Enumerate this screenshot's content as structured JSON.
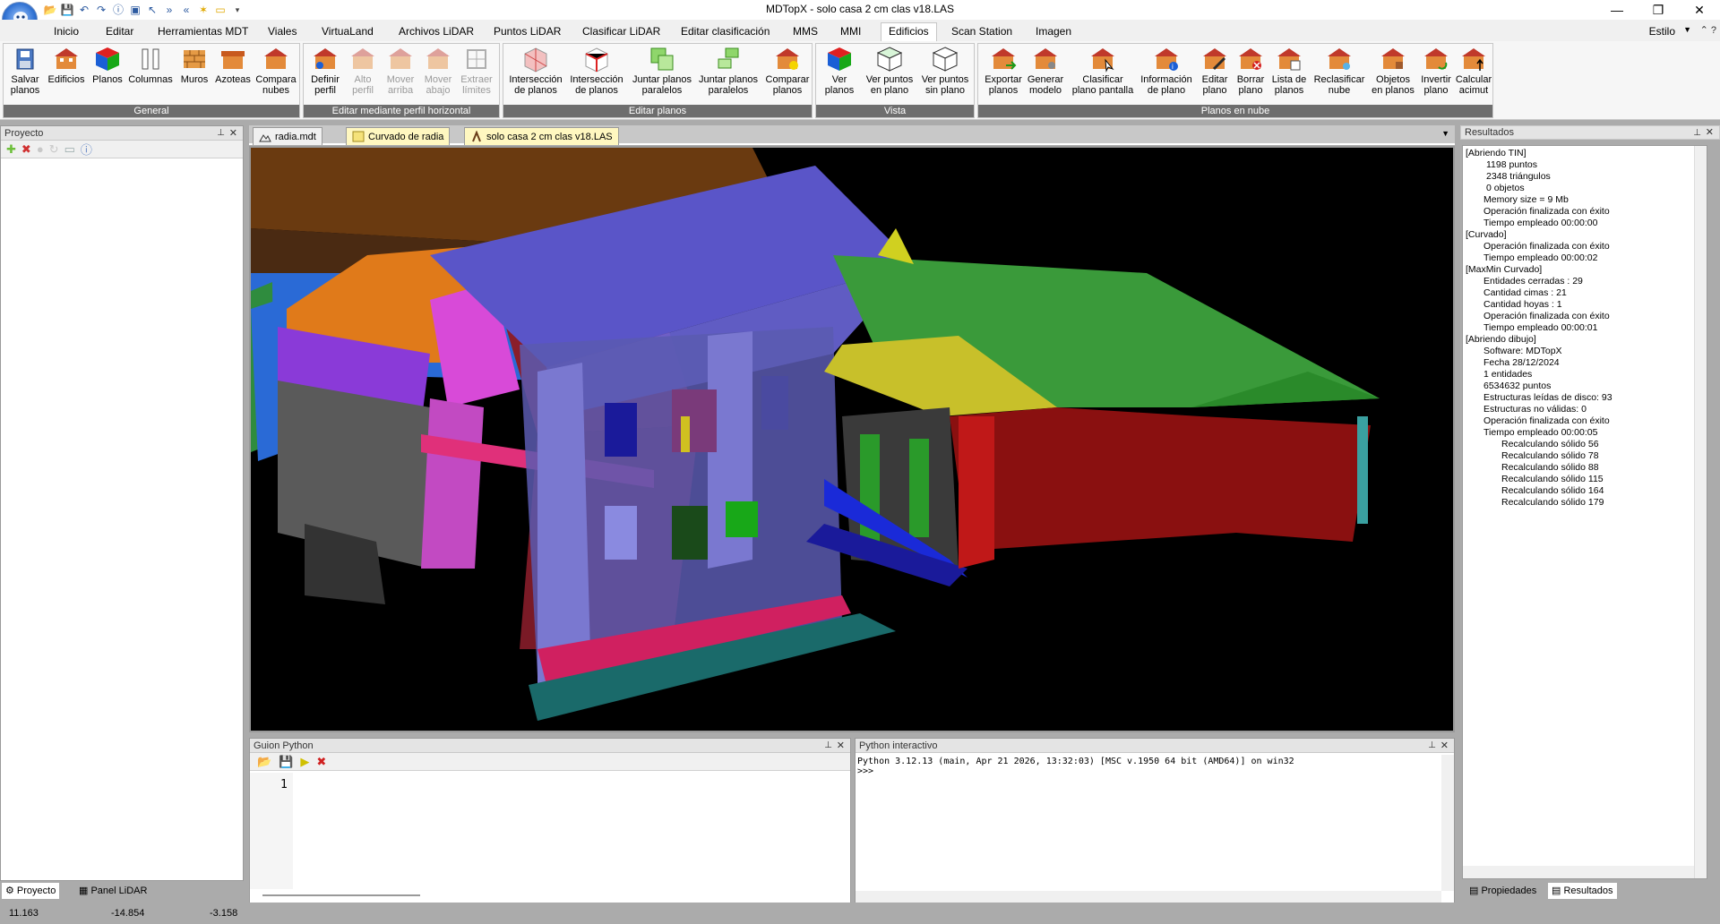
{
  "titlebar": {
    "title": "MDTopX - solo casa 2 cm clas v18.LAS",
    "controls": [
      "—",
      "❐",
      "✕"
    ]
  },
  "menu": {
    "tabs": [
      "Inicio",
      "Editar",
      "Herramientas MDT",
      "Viales",
      "VirtuaLand",
      "Archivos LiDAR",
      "Puntos LiDAR",
      "Clasificar LiDAR",
      "Editar clasificación",
      "MMS",
      "MMI",
      "Edificios",
      "Scan Station",
      "Imagen"
    ],
    "active_tab": "Edificios",
    "style_label": "Estilo"
  },
  "ribbon": {
    "groups": [
      {
        "label": "General",
        "buttons": [
          "Salvar\nplanos",
          "Edificios",
          "Planos",
          "Columnas",
          "Muros",
          "Azoteas",
          "Compara\nnubes"
        ]
      },
      {
        "label": "Editar mediante perfil horizontal",
        "buttons": [
          "Definir\nperfil",
          "Alto\nperfil",
          "Mover\narriba",
          "Mover\nabajo",
          "Extraer\nlímites"
        ]
      },
      {
        "label": "Editar planos",
        "buttons": [
          "Intersección\nde planos",
          "Intersección\nde planos",
          "Juntar planos\nparalelos",
          "Juntar planos\nparalelos",
          "Comparar\nplanos"
        ]
      },
      {
        "label": "Vista",
        "buttons": [
          "Ver\nplanos",
          "Ver puntos\nen plano",
          "Ver puntos\nsin plano"
        ]
      },
      {
        "label": "Planos en nube",
        "buttons": [
          "Exportar\nplanos",
          "Generar\nmodelo",
          "Clasificar\nplano pantalla",
          "Información\nde plano",
          "Editar\nplano",
          "Borrar\nplano",
          "Lista de\nplanos",
          "Reclasificar\nnube",
          "Objetos\nen planos",
          "Invertir\nplano",
          "Calcular\nacimut"
        ]
      }
    ]
  },
  "left_panel": {
    "title": "Proyecto",
    "tabs": [
      "Proyecto",
      "Panel LiDAR"
    ]
  },
  "doc_tabs": [
    "radia.mdt",
    "Curvado de radia",
    "solo casa 2 cm clas v18.LAS"
  ],
  "python_script": {
    "title": "Guion Python",
    "line_number": "1"
  },
  "python_interactive": {
    "title": "Python interactivo",
    "lines": [
      "Python 3.12.13 (main, Apr 21 2026, 13:32:03) [MSC v.1950 64 bit (AMD64)] on win32",
      ">>>"
    ]
  },
  "results": {
    "title": "Resultados",
    "lines": [
      {
        "text": "[Abriendo TIN]",
        "indent": 0
      },
      {
        "text": "1198 puntos",
        "indent": 2
      },
      {
        "text": "2348 triángulos",
        "indent": 2
      },
      {
        "text": "0 objetos",
        "indent": 2
      },
      {
        "text": "Memory size = 9 Mb",
        "indent": 1
      },
      {
        "text": "Operación finalizada con éxito",
        "indent": 1
      },
      {
        "text": "Tiempo empleado 00:00:00",
        "indent": 1
      },
      {
        "text": "[Curvado]",
        "indent": 0
      },
      {
        "text": "Operación finalizada con éxito",
        "indent": 1
      },
      {
        "text": "Tiempo empleado 00:00:02",
        "indent": 1
      },
      {
        "text": "[MaxMin Curvado]",
        "indent": 0
      },
      {
        "text": "Entidades cerradas : 29",
        "indent": 1
      },
      {
        "text": "Cantidad cimas : 21",
        "indent": 1
      },
      {
        "text": "Cantidad hoyas : 1",
        "indent": 1
      },
      {
        "text": "Operación finalizada con éxito",
        "indent": 1
      },
      {
        "text": "Tiempo empleado 00:00:01",
        "indent": 1
      },
      {
        "text": "[Abriendo dibujo]",
        "indent": 0
      },
      {
        "text": "Software: MDTopX",
        "indent": 1
      },
      {
        "text": "Fecha 28/12/2024",
        "indent": 1
      },
      {
        "text": "1 entidades",
        "indent": 1
      },
      {
        "text": "6534632 puntos",
        "indent": 1
      },
      {
        "text": "Estructuras leídas de disco: 93",
        "indent": 1
      },
      {
        "text": "Estructuras no válidas: 0",
        "indent": 1
      },
      {
        "text": "Operación finalizada con éxito",
        "indent": 1
      },
      {
        "text": "Tiempo empleado 00:00:05",
        "indent": 1
      },
      {
        "text": "Recalculando sólido 56",
        "indent": 3
      },
      {
        "text": "Recalculando sólido 78",
        "indent": 3
      },
      {
        "text": "Recalculando sólido 88",
        "indent": 3
      },
      {
        "text": "Recalculando sólido 115",
        "indent": 3
      },
      {
        "text": "Recalculando sólido 164",
        "indent": 3
      },
      {
        "text": "Recalculando sólido 179",
        "indent": 3
      }
    ],
    "tabs": [
      "Propiedades",
      "Resultados"
    ]
  },
  "status": {
    "x": "11.163",
    "y": "-14.854",
    "z": "-3.158"
  },
  "colors": {
    "accent": "#2b5797",
    "group_label_bg": "#6e6e6e",
    "viewport_bg": "#000000",
    "doc_tab_active": "#fff7c0"
  }
}
